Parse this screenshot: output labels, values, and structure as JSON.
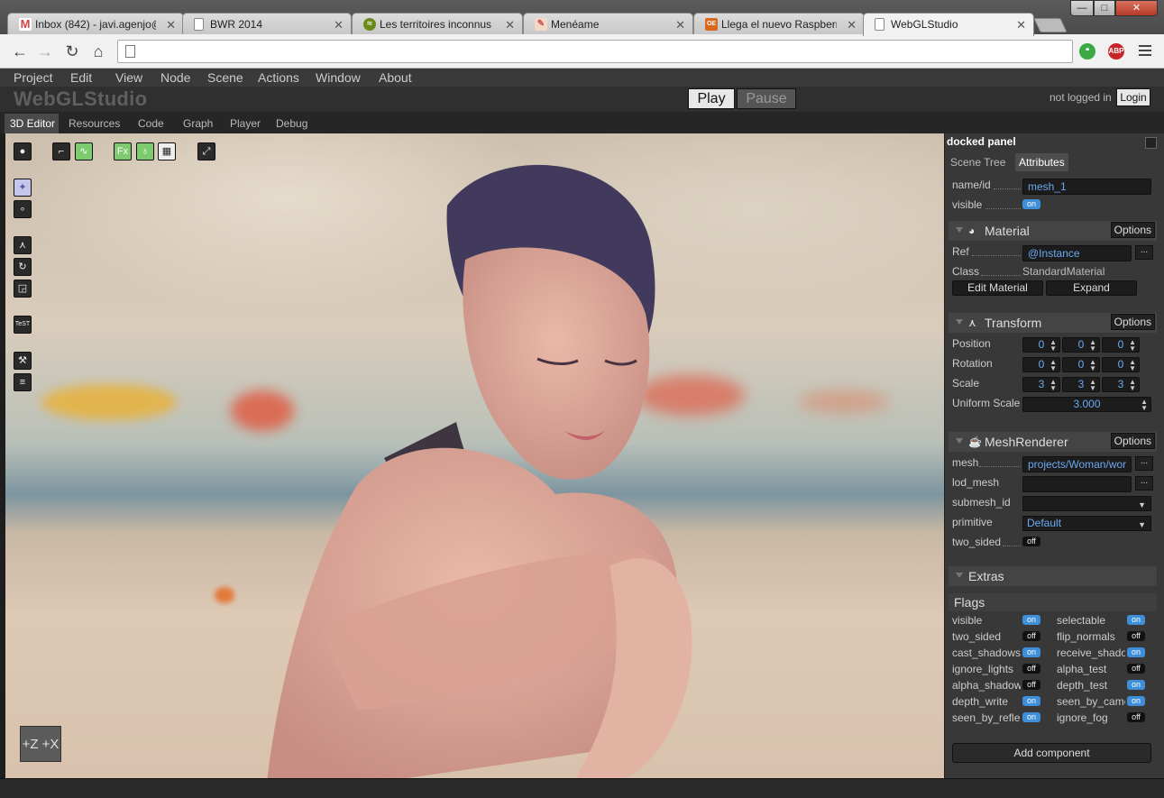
{
  "browser": {
    "tabs": [
      {
        "title": "Inbox (842) - javi.agenjo@",
        "icon": "gmail-icon"
      },
      {
        "title": "BWR 2014",
        "icon": "page-icon"
      },
      {
        "title": "Les territoires inconnus -",
        "icon": "spotify-icon"
      },
      {
        "title": "Menéame",
        "icon": "meneame-icon"
      },
      {
        "title": "Llega el nuevo Raspberry",
        "icon": "raspberry-site-icon"
      },
      {
        "title": "WebGLStudio",
        "icon": "page-icon"
      }
    ],
    "active_tab": 5,
    "address": "",
    "window_controls": {
      "minimize": "—",
      "maximize": "□",
      "close": "✕"
    }
  },
  "app": {
    "menu": [
      "Project",
      "Edit",
      "View",
      "Node",
      "Scene",
      "Actions",
      "Window",
      "About"
    ],
    "logo": "WebGLStudio",
    "play_label": "Play",
    "pause_label": "Pause",
    "login_status": "not logged in",
    "login_button": "Login",
    "editor_tabs": [
      "3D Editor",
      "Resources",
      "Code",
      "Graph",
      "Player",
      "Debug"
    ],
    "active_editor_tab": 0,
    "viewport_tools": {
      "fx_label": "Fx",
      "test_label": "TeST",
      "axis_label": "+Z +X"
    }
  },
  "panel": {
    "title": "docked panel",
    "tabs": [
      "Scene Tree",
      "Attributes"
    ],
    "active_tab": 1,
    "node": {
      "name_label": "name/id",
      "name_value": "mesh_1",
      "visible_label": "visible",
      "visible_value": "on"
    },
    "options_label": "Options",
    "material": {
      "title": "Material",
      "ref_label": "Ref",
      "ref_value": "@Instance",
      "class_label": "Class",
      "class_value": "StandardMaterial",
      "edit_button": "Edit Material",
      "expand_button": "Expand",
      "more_button": "..."
    },
    "transform": {
      "title": "Transform",
      "position_label": "Position",
      "position": [
        "0",
        "0",
        "0"
      ],
      "rotation_label": "Rotation",
      "rotation": [
        "0",
        "0",
        "0"
      ],
      "scale_label": "Scale",
      "scale": [
        "3",
        "3",
        "3"
      ],
      "uniform_label": "Uniform Scale",
      "uniform_value": "3.000"
    },
    "mesh_renderer": {
      "title": "MeshRenderer",
      "mesh_label": "mesh",
      "mesh_value": "projects/Woman/wor",
      "lod_label": "lod_mesh",
      "lod_value": "",
      "submesh_label": "submesh_id",
      "submesh_value": "",
      "primitive_label": "primitive",
      "primitive_value": "Default",
      "two_sided_label": "two_sided",
      "two_sided_value": "off"
    },
    "extras": {
      "title": "Extras",
      "flags_title": "Flags",
      "flags_left": [
        {
          "label": "visible",
          "value": "on"
        },
        {
          "label": "two_sided",
          "value": "off"
        },
        {
          "label": "cast_shadows",
          "value": "on"
        },
        {
          "label": "ignore_lights",
          "value": "off"
        },
        {
          "label": "alpha_shadows",
          "value": "off"
        },
        {
          "label": "depth_write",
          "value": "on"
        },
        {
          "label": "seen_by_reflections",
          "value": "on"
        }
      ],
      "flags_right": [
        {
          "label": "selectable",
          "value": "on"
        },
        {
          "label": "flip_normals",
          "value": "off"
        },
        {
          "label": "receive_shadows",
          "value": "on"
        },
        {
          "label": "alpha_test",
          "value": "off"
        },
        {
          "label": "depth_test",
          "value": "on"
        },
        {
          "label": "seen_by_camera",
          "value": "on"
        },
        {
          "label": "ignore_fog",
          "value": "off"
        }
      ]
    },
    "add_component": "Add component"
  },
  "colors": {
    "accent": "#3e8fd9",
    "field_text": "#6aaaf2",
    "green_tool": "#7ecb6f"
  }
}
